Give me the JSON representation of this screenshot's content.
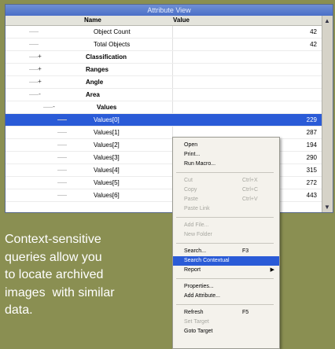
{
  "window": {
    "title": "Attribute View",
    "columns": {
      "name": "Name",
      "value": "Value"
    },
    "rows": [
      {
        "name": "Object Count",
        "value": "42",
        "bold": false,
        "selected": false,
        "expander": "",
        "depth": 0
      },
      {
        "name": "Total Objects",
        "value": "42",
        "bold": false,
        "selected": false,
        "expander": "",
        "depth": 0
      },
      {
        "name": "Classification",
        "value": "",
        "bold": true,
        "selected": false,
        "expander": "+",
        "depth": 0
      },
      {
        "name": "Ranges",
        "value": "",
        "bold": true,
        "selected": false,
        "expander": "+",
        "depth": 0
      },
      {
        "name": "Angle",
        "value": "",
        "bold": true,
        "selected": false,
        "expander": "+",
        "depth": 0
      },
      {
        "name": "Area",
        "value": "",
        "bold": true,
        "selected": false,
        "expander": "-",
        "depth": 0
      },
      {
        "name": "Values",
        "value": "",
        "bold": true,
        "selected": false,
        "expander": "-",
        "depth": 1
      },
      {
        "name": "Values[0]",
        "value": "229",
        "bold": false,
        "selected": true,
        "expander": "",
        "depth": 2
      },
      {
        "name": "Values[1]",
        "value": "287",
        "bold": false,
        "selected": false,
        "expander": "",
        "depth": 2
      },
      {
        "name": "Values[2]",
        "value": "194",
        "bold": false,
        "selected": false,
        "expander": "",
        "depth": 2
      },
      {
        "name": "Values[3]",
        "value": "290",
        "bold": false,
        "selected": false,
        "expander": "",
        "depth": 2
      },
      {
        "name": "Values[4]",
        "value": "315",
        "bold": false,
        "selected": false,
        "expander": "",
        "depth": 2
      },
      {
        "name": "Values[5]",
        "value": "272",
        "bold": false,
        "selected": false,
        "expander": "",
        "depth": 2
      },
      {
        "name": "Values[6]",
        "value": "443",
        "bold": false,
        "selected": false,
        "expander": "",
        "depth": 2
      }
    ]
  },
  "context_menu": {
    "items": [
      {
        "label": "Open",
        "key": "",
        "state": "normal"
      },
      {
        "label": "Print...",
        "key": "",
        "state": "normal"
      },
      {
        "label": "Run Macro...",
        "key": "",
        "state": "normal"
      },
      {
        "sep": true
      },
      {
        "label": "Cut",
        "key": "Ctrl+X",
        "state": "disabled"
      },
      {
        "label": "Copy",
        "key": "Ctrl+C",
        "state": "disabled"
      },
      {
        "label": "Paste",
        "key": "Ctrl+V",
        "state": "disabled"
      },
      {
        "label": "Paste Link",
        "key": "",
        "state": "disabled"
      },
      {
        "sep": true
      },
      {
        "label": "Add File...",
        "key": "",
        "state": "disabled"
      },
      {
        "label": "New Folder",
        "key": "",
        "state": "disabled"
      },
      {
        "sep": true
      },
      {
        "label": "Search...",
        "key": "F3",
        "state": "normal"
      },
      {
        "label": "Search Contextual",
        "key": "",
        "state": "highlight"
      },
      {
        "label": "Report",
        "key": "",
        "state": "normal",
        "submenu": true
      },
      {
        "sep": true
      },
      {
        "label": "Properties...",
        "key": "",
        "state": "normal"
      },
      {
        "label": "Add Attribute...",
        "key": "",
        "state": "normal"
      },
      {
        "sep": true
      },
      {
        "label": "Refresh",
        "key": "F5",
        "state": "normal"
      },
      {
        "label": "Set Target",
        "key": "",
        "state": "disabled"
      },
      {
        "label": "Goto Target",
        "key": "",
        "state": "normal"
      }
    ]
  },
  "caption": {
    "lines": [
      "Context-sensitive",
      "queries allow you",
      "to locate archived",
      "images  with similar",
      "data."
    ]
  },
  "colors": {
    "accent": "#2a5bd7",
    "background": "#8a8f52"
  }
}
